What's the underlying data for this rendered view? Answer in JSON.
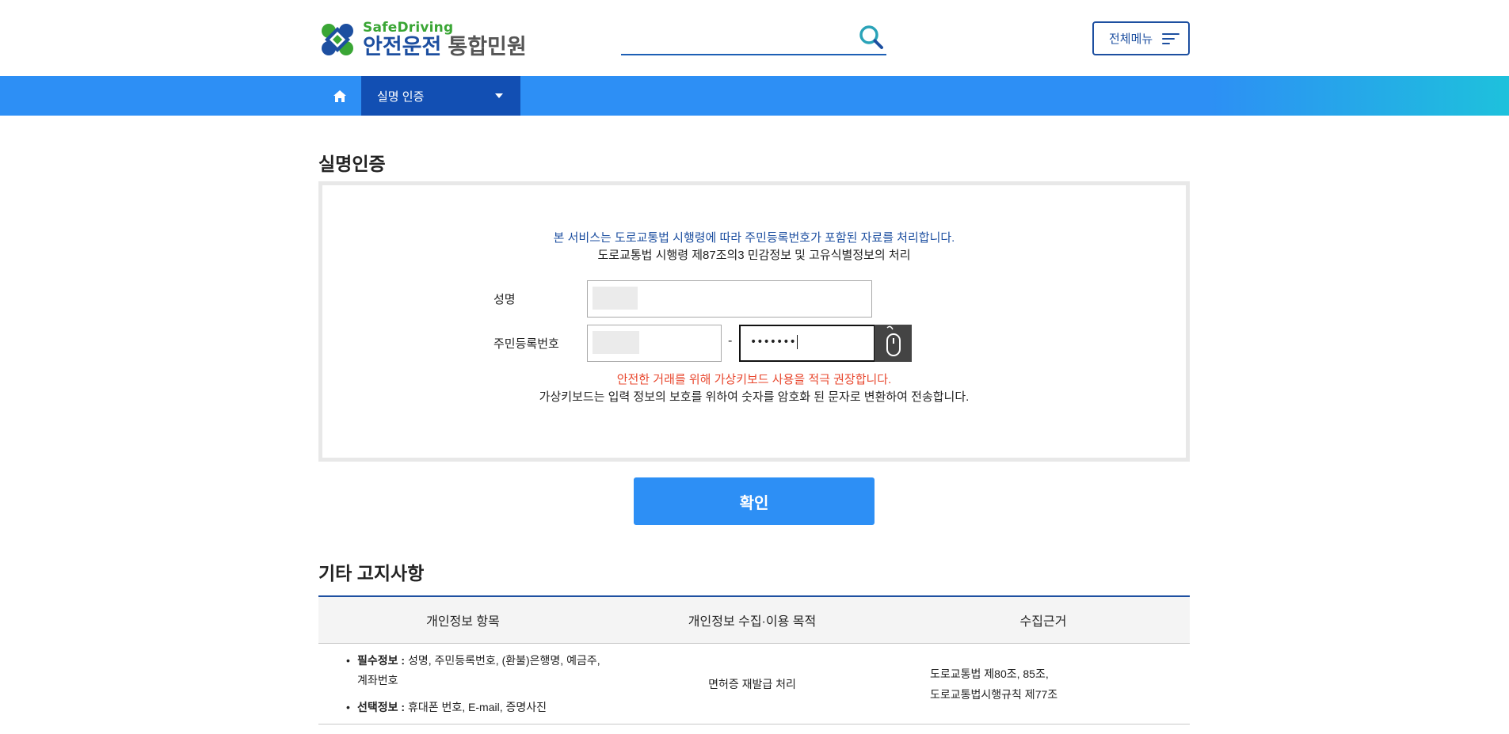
{
  "header": {
    "logo_sub": "SafeDriving",
    "logo_main_a": "안전운전",
    "logo_main_b": "통합민원",
    "search_icon": "search-icon",
    "all_menu_label": "전체메뉴",
    "all_menu_icon": "hamburger-icon"
  },
  "nav": {
    "home_icon": "home-icon",
    "current": "실명 인증"
  },
  "page_title": "실명인증",
  "auth": {
    "notice_blue": "본 서비스는 도로교통법 시행령에 따라 주민등록번호가 포함된 자료를 처리합니다.",
    "notice_black": "도로교통법 시행령 제87조의3 민감정보 및 고유식별정보의 처리",
    "name_label": "성명",
    "rrn_label": "주민등록번호",
    "dash": "-",
    "rrn_back_value": "•••••••",
    "vkbd_icon": "mouse-icon",
    "warn_red": "안전한 거래를 위해 가상키보드 사용을 적극 권장합니다.",
    "warn_black": "가상키보드는 입력 정보의 보호를 위하여 숫자를 암호화 된 문자로 변환하여 전송합니다."
  },
  "confirm_label": "확인",
  "section_title": "기타 고지사항",
  "table": {
    "headers": [
      "개인정보 항목",
      "개인정보 수집·이용 목적",
      "수집근거"
    ],
    "row": {
      "required_label": "필수정보 :",
      "required_text": " 성명, 주민등록번호, (환불)은행명, 예금주, 계좌번호",
      "optional_label": "선택정보 :",
      "optional_text": " 휴대폰 번호, E-mail, 증명사진",
      "purpose": "면허증 재발급 처리",
      "basis_1": "도로교통법 제80조, 85조,",
      "basis_2": "도로교통법시행규칙 제77조"
    }
  },
  "colors": {
    "brand_blue": "#1d4fa0",
    "nav_blue": "#2d8ff5",
    "warn_red": "#e8472e",
    "logo_green": "#3aa635"
  }
}
